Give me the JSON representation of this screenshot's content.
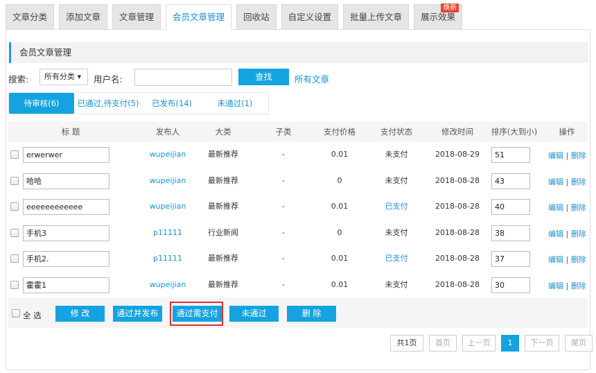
{
  "tabs": [
    {
      "label": "文章分类"
    },
    {
      "label": "添加文章"
    },
    {
      "label": "文章管理"
    },
    {
      "label": "会员文章管理"
    },
    {
      "label": "回收站"
    },
    {
      "label": "自定义设置"
    },
    {
      "label": "批量上传文章"
    },
    {
      "label": "展示效果",
      "badge": "焕新"
    }
  ],
  "section_title": "会员文章管理",
  "search": {
    "label": "搜索:",
    "category": "所有分类 ▾",
    "username_label": "用户名:",
    "username_value": "",
    "button": "查找",
    "all_link": "所有文章"
  },
  "subtabs": [
    {
      "label": "待审核(6)"
    },
    {
      "label": "已通过,待支付(5)"
    },
    {
      "label": "已发布(14)"
    },
    {
      "label": "未通过(1)"
    }
  ],
  "columns": [
    "标  题",
    "发布人",
    "大类",
    "子类",
    "支付价格",
    "支付状态",
    "修改时间",
    "排序(大到小)",
    "操作"
  ],
  "rows": [
    {
      "title": "erwerwer",
      "publisher": "wupeijian",
      "category": "最新推荐",
      "subcategory": "-",
      "price": "0.01",
      "status": "未支付",
      "time": "2018-08-29",
      "sort": "51"
    },
    {
      "title": "哈哈",
      "publisher": "wupeijian",
      "category": "最新推荐",
      "subcategory": "-",
      "price": "0",
      "status": "未支付",
      "time": "2018-08-28",
      "sort": "43"
    },
    {
      "title": "eeeeeeeeeeee",
      "publisher": "wupeijian",
      "category": "最新推荐",
      "subcategory": "-",
      "price": "0.01",
      "status": "已支付",
      "time": "2018-08-28",
      "sort": "40"
    },
    {
      "title": "手机3",
      "publisher": "p11111",
      "category": "行业新闻",
      "subcategory": "-",
      "price": "0",
      "status": "未支付",
      "time": "2018-08-28",
      "sort": "38"
    },
    {
      "title": "手机2.",
      "publisher": "p11111",
      "category": "最新推荐",
      "subcategory": "-",
      "price": "0.01",
      "status": "已支付",
      "time": "2018-08-28",
      "sort": "37"
    },
    {
      "title": "霍霍1",
      "publisher": "wupeijian",
      "category": "最新推荐",
      "subcategory": "-",
      "price": "0.01",
      "status": "未支付",
      "time": "2018-08-28",
      "sort": "30"
    }
  ],
  "ops": {
    "edit": "编辑",
    "sep": "|",
    "delete": "删除"
  },
  "footer": {
    "select_all": "全 选",
    "buttons": [
      "修 改",
      "通过并发布",
      "通过需支付",
      "未通过",
      "删 除"
    ]
  },
  "pager": [
    "共1页",
    "首页",
    "上一页",
    "1",
    "下一页",
    "尾页"
  ]
}
